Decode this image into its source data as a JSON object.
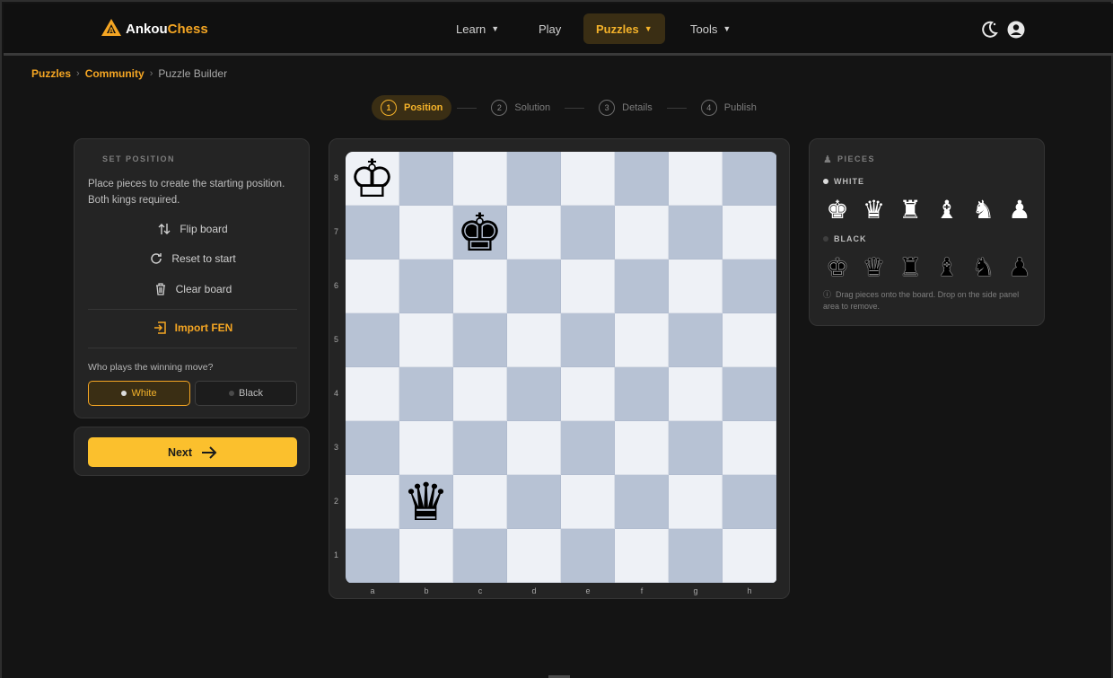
{
  "app": {
    "brand_prefix": "Ankou",
    "brand_suffix": "Chess"
  },
  "nav": {
    "learn": "Learn",
    "play": "Play",
    "puzzles": "Puzzles",
    "tools": "Tools",
    "theme_icon": "moon-icon",
    "account_icon": "user-circle-icon"
  },
  "breadcrumb": {
    "items": [
      "Puzzles",
      "Community"
    ],
    "current": "Puzzle Builder"
  },
  "stepper": {
    "steps": [
      {
        "num": "1",
        "label": "Position",
        "active": true
      },
      {
        "num": "2",
        "label": "Solution"
      },
      {
        "num": "3",
        "label": "Details"
      },
      {
        "num": "4",
        "label": "Publish"
      }
    ]
  },
  "setup": {
    "heading": "SET POSITION",
    "description": "Place pieces to create the starting position. Both kings required.",
    "flip": "Flip board",
    "reset": "Reset to start",
    "clear": "Clear board",
    "import": "Import FEN",
    "who_question": "Who plays the winning move?",
    "white": "White",
    "black": "Black",
    "selected_side": "White"
  },
  "next_button": "Next",
  "board": {
    "files": [
      "a",
      "b",
      "c",
      "d",
      "e",
      "f",
      "g",
      "h"
    ],
    "ranks": [
      "8",
      "7",
      "6",
      "5",
      "4",
      "3",
      "2",
      "1"
    ],
    "pieces": [
      {
        "square": "a8",
        "glyph": "♔",
        "name": "white-king"
      },
      {
        "square": "c7",
        "glyph": "♚",
        "name": "black-king"
      },
      {
        "square": "b2",
        "glyph": "♛",
        "name": "black-queen"
      }
    ]
  },
  "pieces_panel": {
    "heading": "PIECES",
    "white_label": "WHITE",
    "black_label": "BLACK",
    "white": [
      {
        "glyph": "♚",
        "name": "king"
      },
      {
        "glyph": "♛",
        "name": "queen"
      },
      {
        "glyph": "♜",
        "name": "rook"
      },
      {
        "glyph": "♝",
        "name": "bishop"
      },
      {
        "glyph": "♞",
        "name": "knight"
      },
      {
        "glyph": "♟",
        "name": "pawn"
      }
    ],
    "black": [
      {
        "glyph": "♚",
        "name": "king"
      },
      {
        "glyph": "♛",
        "name": "queen"
      },
      {
        "glyph": "♜",
        "name": "rook"
      },
      {
        "glyph": "♝",
        "name": "bishop"
      },
      {
        "glyph": "♞",
        "name": "knight"
      },
      {
        "glyph": "♟",
        "name": "pawn"
      }
    ],
    "hint": "Drag pieces onto the board. Drop on the side panel area to remove."
  },
  "colors": {
    "accent": "#f5a623",
    "next": "#fbc02d",
    "light_square": "#eef1f6",
    "dark_square": "#b7c2d4"
  }
}
